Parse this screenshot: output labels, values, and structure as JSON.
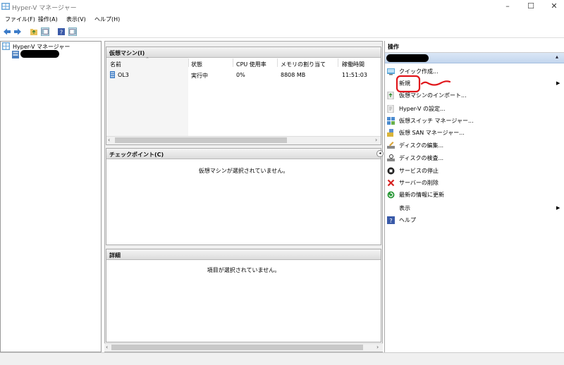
{
  "window": {
    "title": "Hyper-V マネージャー",
    "min": "–",
    "max": "☐",
    "close": "✕"
  },
  "menu": [
    "ファイル(F)",
    "操作(A)",
    "表示(V)",
    "ヘルプ(H)"
  ],
  "tree": {
    "root": "Hyper-V マネージャー"
  },
  "vms": {
    "section_title": "仮想マシン(I)",
    "columns": [
      "名前",
      "状態",
      "CPU 使用率",
      "メモリの割り当て",
      "稼働時間"
    ],
    "rows": [
      {
        "name": "OL3",
        "state": "実行中",
        "cpu": "0%",
        "memory": "8808 MB",
        "uptime": "11:51:03"
      }
    ]
  },
  "checkpoints": {
    "section_title": "チェックポイント(C)",
    "empty_text": "仮想マシンが選択されていません。"
  },
  "details": {
    "section_title": "詳細",
    "empty_text": "項目が選択されていません。"
  },
  "actions": {
    "section_title": "操作",
    "items": [
      {
        "label": "クイック作成...",
        "icon": "quick-create-icon"
      },
      {
        "label": "新規",
        "icon": "",
        "submenu": "▶"
      },
      {
        "label": "仮想マシンのインポート...",
        "icon": "import-icon"
      },
      {
        "label": "Hyper-V の設定...",
        "icon": "settings-icon"
      },
      {
        "label": "仮想スイッチ マネージャー...",
        "icon": "switch-icon"
      },
      {
        "label": "仮想 SAN マネージャー...",
        "icon": "san-icon"
      },
      {
        "label": "ディスクの編集...",
        "icon": "disk-edit-icon"
      },
      {
        "label": "ディスクの検査...",
        "icon": "disk-inspect-icon"
      },
      {
        "label": "サービスの停止",
        "icon": "stop-icon"
      },
      {
        "label": "サーバーの削除",
        "icon": "delete-icon"
      },
      {
        "label": "最新の情報に更新",
        "icon": "refresh-icon"
      },
      {
        "label": "表示",
        "icon": "",
        "submenu": "▶"
      },
      {
        "label": "ヘルプ",
        "icon": "help-icon"
      }
    ]
  },
  "colors": {
    "selection": "#cde3f7",
    "accent": "#3a7bd5",
    "annotation": "#e0161b"
  }
}
